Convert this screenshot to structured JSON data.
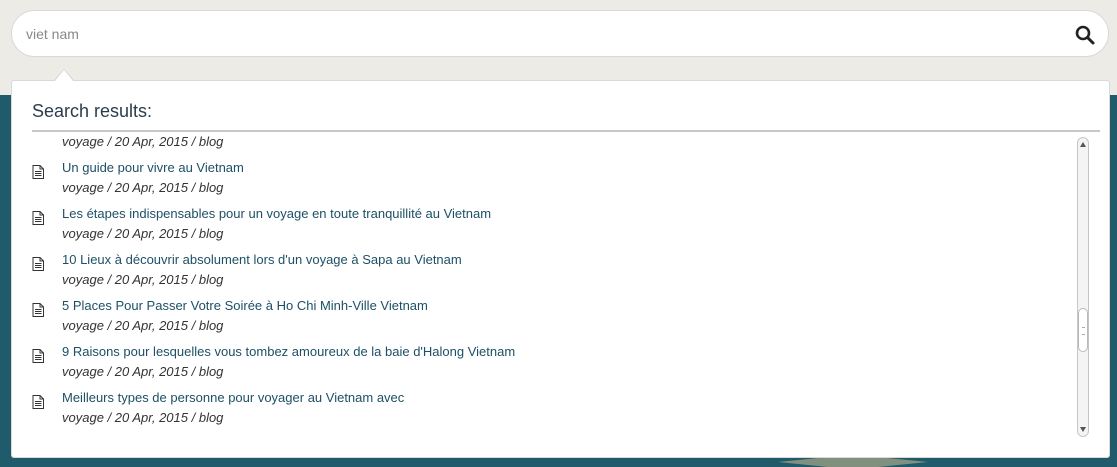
{
  "search": {
    "value": "",
    "placeholder": "viet nam"
  },
  "results": {
    "heading": "Search results:",
    "items": [
      {
        "title": "",
        "meta": "voyage / 20 Apr, 2015 / blog"
      },
      {
        "title": "Un guide pour vivre au Vietnam",
        "meta": "voyage / 20 Apr, 2015 / blog"
      },
      {
        "title": "Les étapes indispensables pour un voyage en toute tranquillité au Vietnam",
        "meta": "voyage / 20 Apr, 2015 / blog"
      },
      {
        "title": "10 Lieux à découvrir absolument lors d'un voyage à Sapa au Vietnam",
        "meta": "voyage / 20 Apr, 2015 / blog"
      },
      {
        "title": "5 Places Pour Passer Votre Soirée à Ho Chi Minh-Ville Vietnam",
        "meta": "voyage / 20 Apr, 2015 / blog"
      },
      {
        "title": "9 Raisons pour lesquelles vous tombez amoureux de la baie d'Halong Vietnam",
        "meta": "voyage / 20 Apr, 2015 / blog"
      },
      {
        "title": "Meilleurs types de personne pour voyager au Vietnam avec",
        "meta": "voyage / 20 Apr, 2015 / blog"
      }
    ]
  },
  "icons": {
    "search": "search-icon",
    "result": "document-icon"
  },
  "colors": {
    "link": "#1d4f66",
    "page_band": "#1f5b6b",
    "page_bg": "#ecebe6"
  }
}
